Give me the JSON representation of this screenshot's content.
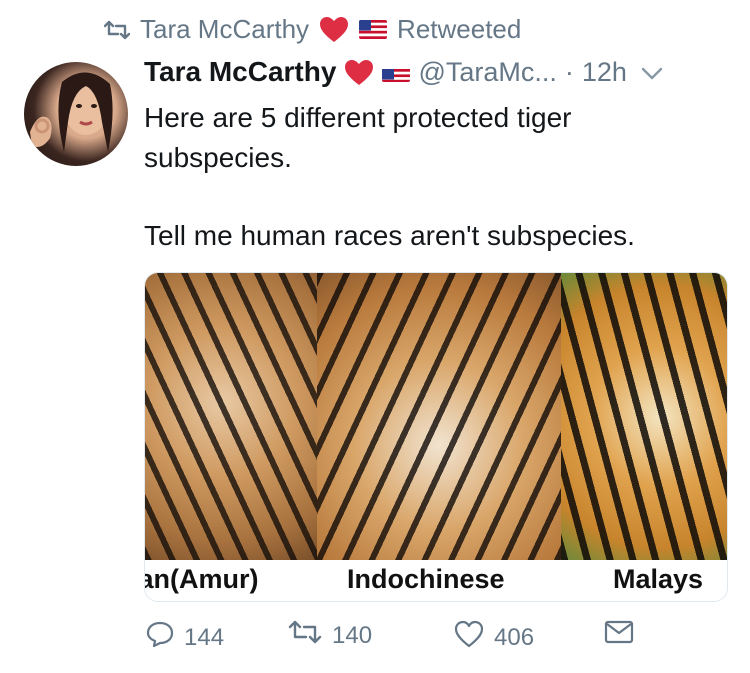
{
  "retweet_context": {
    "name": "Tara McCarthy",
    "label": "Retweeted"
  },
  "tweet": {
    "display_name": "Tara McCarthy",
    "handle": "@TaraMc...",
    "separator": "·",
    "time": "12h",
    "paragraphs": [
      "Here are 5 different protected tiger subspecies.",
      "Tell me human races aren't subspecies."
    ],
    "media": {
      "labels": [
        "ian(Amur)",
        "Indochinese",
        "Malays"
      ]
    },
    "actions": {
      "replies": "144",
      "retweets": "140",
      "likes": "406"
    }
  },
  "icons": {
    "retweet": "retweet-icon",
    "heart": "red-heart-emoji-icon",
    "flag": "us-flag-emoji-icon",
    "chevron": "chevron-down-icon",
    "reply": "reply-icon",
    "like": "like-heart-icon",
    "dm": "direct-message-icon"
  },
  "colors": {
    "secondary_text": "#657786",
    "primary_text": "#14171a",
    "heart_red": "#dd2e44"
  }
}
